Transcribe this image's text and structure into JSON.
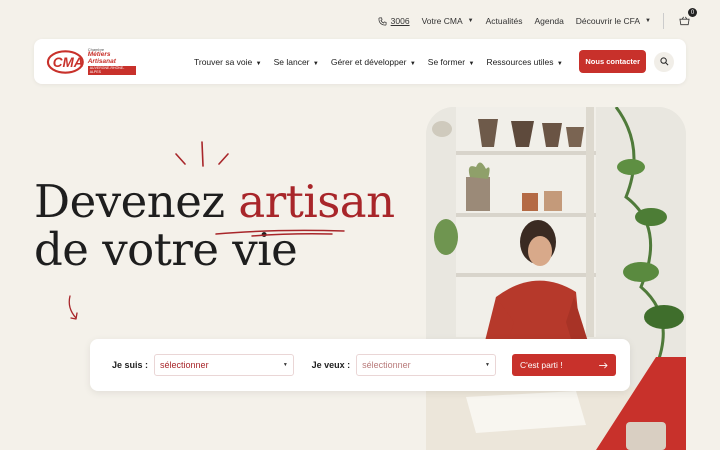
{
  "topbar": {
    "phone": "3006",
    "votre_cma": "Votre CMA",
    "actualites": "Actualités",
    "agenda": "Agenda",
    "cfa": "Découvrir le CFA",
    "cart_count": "0"
  },
  "logo": {
    "line1": "Chambre",
    "line2": "Métiers",
    "line3": "Artisanat",
    "line4": "AUVERGNE-RHÔNE-ALPES"
  },
  "nav": {
    "items": [
      "Trouver sa voie",
      "Se lancer",
      "Gérer et développer",
      "Se former",
      "Ressources utiles"
    ],
    "contact": "Nous contacter"
  },
  "hero": {
    "line1_a": "Devenez ",
    "line1_b": "artisan",
    "line2": "de votre vie"
  },
  "search": {
    "label_suis": "Je suis :",
    "value_suis": "sélectionner",
    "label_veux": "Je veux :",
    "value_veux": "sélectionner",
    "cta": "C'est parti !"
  },
  "colors": {
    "accent": "#c8312b",
    "background": "#f4f1ea"
  }
}
